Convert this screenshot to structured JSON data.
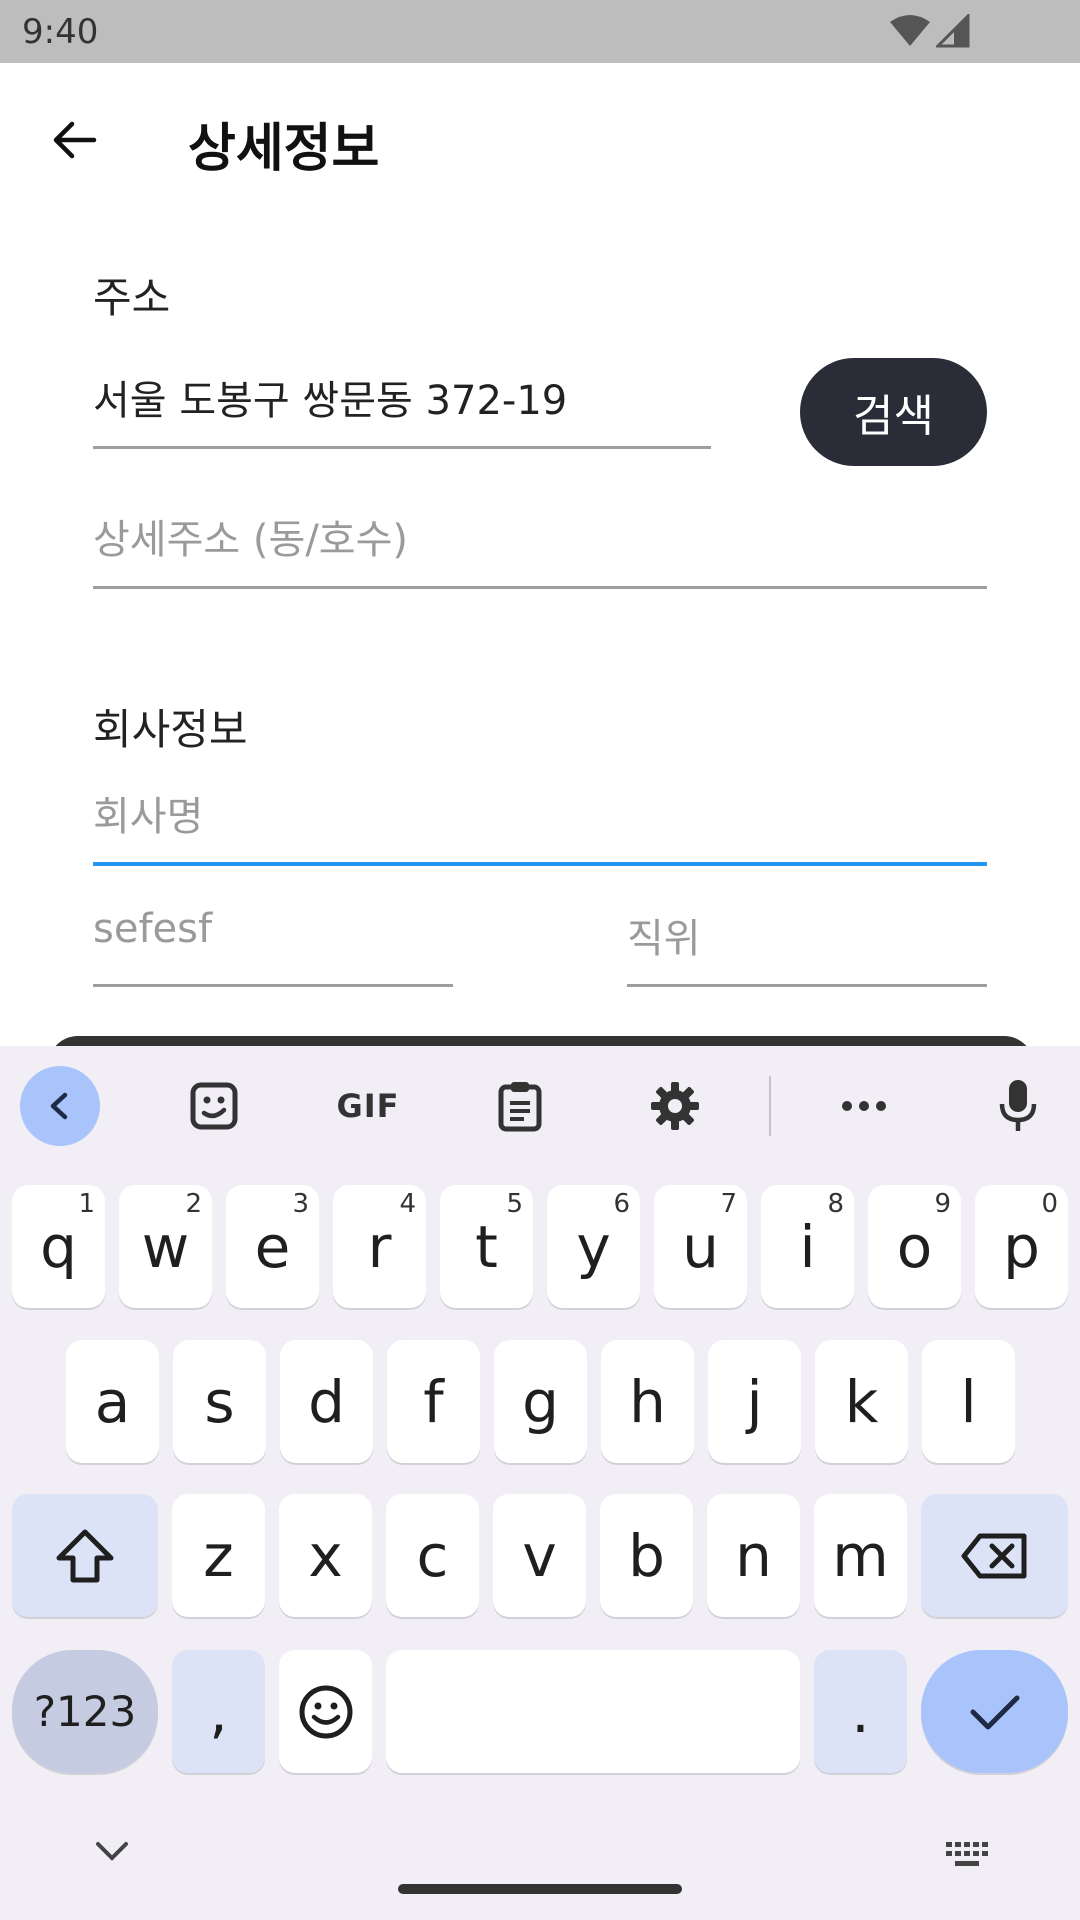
{
  "status_bar": {
    "time": "9:40"
  },
  "app_bar": {
    "title": "상세정보"
  },
  "address": {
    "label": "주소",
    "value": "서울 도봉구 쌍문동 372-19",
    "search_label": "검색",
    "detail_placeholder": "상세주소 (동/호수)"
  },
  "company": {
    "label": "회사정보",
    "name_placeholder": "회사명",
    "department_value": "sefesf",
    "position_placeholder": "직위"
  },
  "keyboard": {
    "toolbar": {
      "gif": "GIF"
    },
    "row1": [
      {
        "k": "q",
        "h": "1"
      },
      {
        "k": "w",
        "h": "2"
      },
      {
        "k": "e",
        "h": "3"
      },
      {
        "k": "r",
        "h": "4"
      },
      {
        "k": "t",
        "h": "5"
      },
      {
        "k": "y",
        "h": "6"
      },
      {
        "k": "u",
        "h": "7"
      },
      {
        "k": "i",
        "h": "8"
      },
      {
        "k": "o",
        "h": "9"
      },
      {
        "k": "p",
        "h": "0"
      }
    ],
    "row2": [
      "a",
      "s",
      "d",
      "f",
      "g",
      "h",
      "j",
      "k",
      "l"
    ],
    "row3": [
      "z",
      "x",
      "c",
      "v",
      "b",
      "n",
      "m"
    ],
    "symbols_label": "?123",
    "comma": ",",
    "period": "."
  }
}
